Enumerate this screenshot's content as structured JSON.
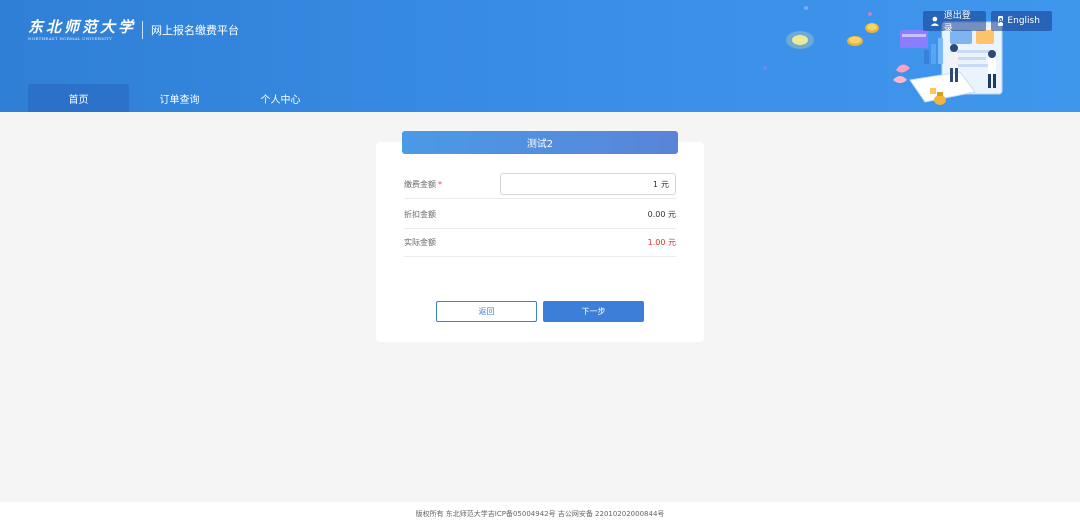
{
  "header": {
    "logo_cn": "东北师范大学",
    "logo_en": "NORTHEAST NORMAL UNIVERSITY",
    "platform_title": "网上报名缴费平台",
    "logout_label": "退出登录",
    "lang_icon_text": "A",
    "lang_label": "English",
    "brand_color": "#3a8ee6"
  },
  "nav": {
    "items": [
      {
        "label": "首页",
        "active": true
      },
      {
        "label": "订单查询",
        "active": false
      },
      {
        "label": "个人中心",
        "active": false
      }
    ]
  },
  "panel": {
    "title": "测试2",
    "fields": {
      "amount_label": "缴费金额",
      "required_mark": "*",
      "amount_value": "1",
      "amount_unit": "元",
      "discount_label": "折扣金额",
      "discount_value": "0.00 元",
      "actual_label": "实际金额",
      "actual_value": "1.00  元"
    },
    "back_label": "返回",
    "next_label": "下一步"
  },
  "footer": {
    "text": "版权所有 东北师范大学吉ICP备05004942号 吉公网安备 22010202000844号"
  }
}
